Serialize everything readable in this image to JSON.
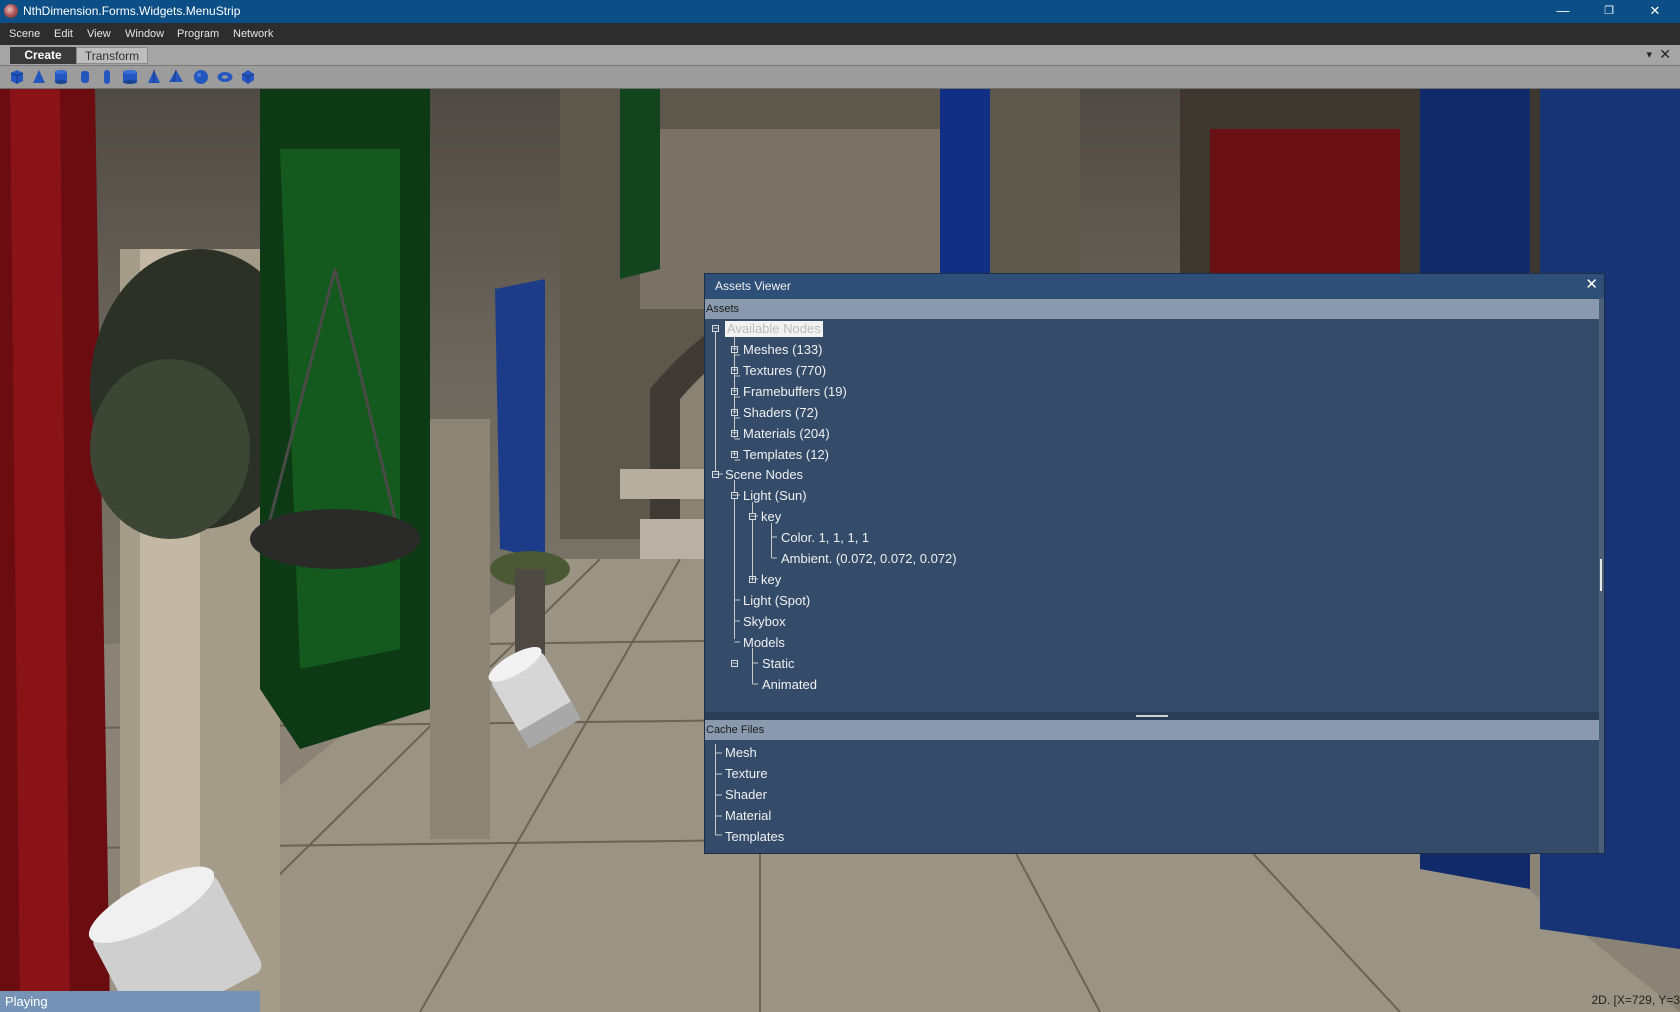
{
  "window": {
    "title": "NthDimension.Forms.Widgets.MenuStrip",
    "controls": {
      "minimize": "—",
      "restore": "❐",
      "close": "✕"
    }
  },
  "menu": [
    "Scene",
    "Edit",
    "View",
    "Window",
    "Program",
    "Network"
  ],
  "tabs": {
    "active": "Create",
    "other": "Transform",
    "pin_icon": "▾",
    "close_icon": "✕"
  },
  "toolbar": {
    "tools": [
      "cube-icon",
      "cone-icon",
      "cylinder-icon",
      "capsule-icon",
      "tube-icon",
      "drum-icon",
      "pyramid-icon",
      "tetrahedron-icon",
      "sphere-icon",
      "torus-icon",
      "icosphere-icon"
    ],
    "tool_color": "#1f4fb0"
  },
  "assets_viewer": {
    "title": "Assets Viewer",
    "close_icon": "✕",
    "assets_header": "Assets",
    "available_nodes": "Available Nodes",
    "available_children": [
      "Meshes (133)",
      "Textures (770)",
      "Framebuffers (19)",
      "Shaders (72)",
      "Materials (204)",
      "Templates (12)"
    ],
    "scene_nodes": "Scene Nodes",
    "light_sun": "Light (Sun)",
    "key_expanded": "key",
    "key_color": "Color. 1, 1, 1, 1",
    "key_ambient": "Ambient. (0.072, 0.072, 0.072)",
    "key_collapsed": "key",
    "light_spot": "Light (Spot)",
    "skybox": "Skybox",
    "models": "Models",
    "models_children": [
      "Static",
      "Animated"
    ],
    "cache_header": "Cache Files",
    "cache_items": [
      "Mesh",
      "Texture",
      "Shader",
      "Material",
      "Templates"
    ],
    "colors": {
      "panel": "#344c6a",
      "title": "#2e4f78",
      "header": "#8a9aae"
    }
  },
  "status": {
    "text": "Playing",
    "coords": "2D. [X=729, Y=3"
  }
}
